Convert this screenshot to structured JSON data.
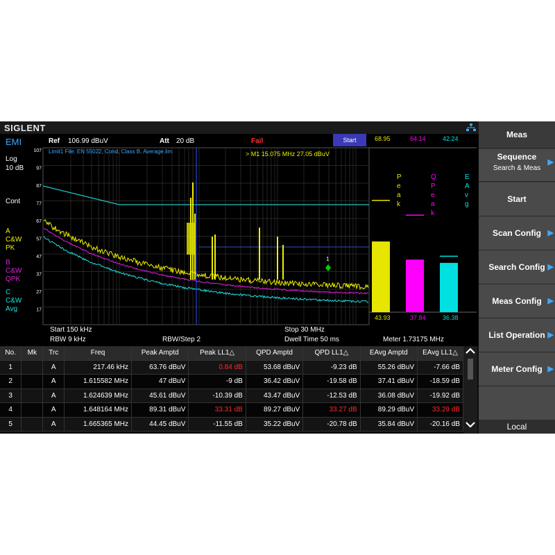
{
  "brand": "SIGLENT",
  "mode": "EMI",
  "left": {
    "scale_type": "Log",
    "scale_div": "10 dB",
    "sweep_mode": "Cont",
    "traces": [
      {
        "letter": "A",
        "line1": "C&W",
        "line2": "PK",
        "color": "#f0f000"
      },
      {
        "letter": "B",
        "line1": "C&W",
        "line2": "QPK",
        "color": "#e020e0"
      },
      {
        "letter": "C",
        "line1": "C&W",
        "line2": "Avg",
        "color": "#20e0e0"
      }
    ]
  },
  "infobar": {
    "ref_label": "Ref",
    "ref_value": "106.99 dBuV",
    "att_label": "Att",
    "att_value": "20 dB",
    "status": "Fail",
    "start_button": "Start"
  },
  "plot": {
    "limit_file": "Limit1 File: EN 55022, Cond, Class B, Average.lim",
    "marker_readout": ">  M1    15.075 MHz   27.05 dBuV",
    "marker_label": "1",
    "y_ticks": [
      "107",
      "97",
      "87",
      "77",
      "67",
      "57",
      "47",
      "37",
      "27",
      "17"
    ]
  },
  "meters": [
    {
      "top_value": "68.95",
      "label": "Peak",
      "bottom_value": "43.93",
      "color": "#e6e600",
      "fill": 0.43,
      "hold": 0.68
    },
    {
      "top_value": "64.14",
      "label": "QPeak",
      "bottom_value": "37.84",
      "color": "#ff00ff",
      "fill": 0.32,
      "hold": 0.59
    },
    {
      "top_value": "42.24",
      "label": "EAvg",
      "bottom_value": "36.38",
      "color": "#00e0e0",
      "fill": 0.3,
      "hold": 0.34
    }
  ],
  "bottom_info": {
    "start": "Start  150 kHz",
    "rbw": "RBW  9 kHz",
    "rbw_step": "RBW/Step    2",
    "stop": "Stop  30 MHz",
    "dwell": "Dwell Time    50 ms",
    "meter": "Meter  1.73175 MHz"
  },
  "table": {
    "headers": [
      "No.",
      "Mk",
      "Trc",
      "Freq",
      "Peak Amptd",
      "Peak LL1△",
      "QPD Amptd",
      "QPD LL1△",
      "EAvg Amptd",
      "EAvg LL1△"
    ],
    "rows": [
      {
        "no": "1",
        "mk": "",
        "trc": "A",
        "freq": "217.46 kHz",
        "peak_amptd": "63.76 dBuV",
        "peak_ll1": "0.84 dB",
        "qpd_amptd": "53.68 dBuV",
        "qpd_ll1": "-9.23 dB",
        "eavg_amptd": "55.26 dBuV",
        "eavg_ll1": "-7.66 dB"
      },
      {
        "no": "2",
        "mk": "",
        "trc": "A",
        "freq": "1.615582 MHz",
        "peak_amptd": "47 dBuV",
        "peak_ll1": "-9 dB",
        "qpd_amptd": "36.42 dBuV",
        "qpd_ll1": "-19.58 dB",
        "eavg_amptd": "37.41 dBuV",
        "eavg_ll1": "-18.59 dB"
      },
      {
        "no": "3",
        "mk": "",
        "trc": "A",
        "freq": "1.624639 MHz",
        "peak_amptd": "45.61 dBuV",
        "peak_ll1": "-10.39 dB",
        "qpd_amptd": "43.47 dBuV",
        "qpd_ll1": "-12.53 dB",
        "eavg_amptd": "36.08 dBuV",
        "eavg_ll1": "-19.92 dB"
      },
      {
        "no": "4",
        "mk": "",
        "trc": "A",
        "freq": "1.648164 MHz",
        "peak_amptd": "89.31 dBuV",
        "peak_ll1": "33.31 dB",
        "qpd_amptd": "89.27 dBuV",
        "qpd_ll1": "33.27 dB",
        "eavg_amptd": "89.29 dBuV",
        "eavg_ll1": "33.29 dB"
      },
      {
        "no": "5",
        "mk": "",
        "trc": "A",
        "freq": "1.665365 MHz",
        "peak_amptd": "44.45 dBuV",
        "peak_ll1": "-11.55 dB",
        "qpd_amptd": "35.22 dBuV",
        "qpd_ll1": "-20.78 dB",
        "eavg_amptd": "35.84 dBuV",
        "eavg_ll1": "-20.16 dB"
      }
    ]
  },
  "menu": {
    "title": "Meas",
    "items": [
      {
        "label": "Sequence",
        "sub": "Search & Meas",
        "arrow": true
      },
      {
        "label": "Start",
        "sub": "",
        "arrow": false
      },
      {
        "label": "Scan Config",
        "sub": "",
        "arrow": true
      },
      {
        "label": "Search Config",
        "sub": "",
        "arrow": true
      },
      {
        "label": "Meas Config",
        "sub": "",
        "arrow": true
      },
      {
        "label": "List Operation",
        "sub": "",
        "arrow": true
      },
      {
        "label": "Meter Config",
        "sub": "",
        "arrow": true
      },
      {
        "label": "",
        "sub": "",
        "arrow": false
      }
    ],
    "footer": "Local"
  }
}
